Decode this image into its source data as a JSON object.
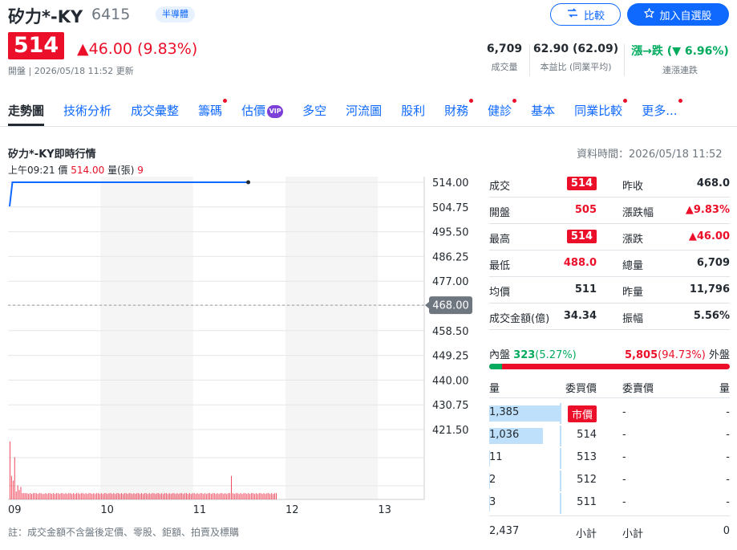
{
  "header": {
    "name": "矽力*-KY",
    "code": "6415",
    "badge": "半導體",
    "compare_label": "比較",
    "add_label": "加入自選股",
    "price": "514",
    "change": "▲46.00 (9.83%)",
    "update": "開盤 | 2026/05/18 11:52 更新"
  },
  "stats": [
    {
      "value": "6,709",
      "label": "成交量"
    },
    {
      "value": "62.90 (62.09)",
      "label": "本益比 (同業平均)"
    },
    {
      "value": "漲→跌 (▼ 6.96%)",
      "label": "連漲連跌"
    }
  ],
  "tabs": [
    {
      "label": "走勢圖",
      "active": true,
      "dot": false
    },
    {
      "label": "技術分析",
      "dot": false
    },
    {
      "label": "成交彙整",
      "dot": false
    },
    {
      "label": "籌碼",
      "dot": true
    },
    {
      "label": "估價",
      "dot": false,
      "vip": "VIP"
    },
    {
      "label": "多空",
      "dot": false
    },
    {
      "label": "河流圖",
      "dot": false
    },
    {
      "label": "股利",
      "dot": false
    },
    {
      "label": "財務",
      "dot": true
    },
    {
      "label": "健診",
      "dot": true
    },
    {
      "label": "基本",
      "dot": false
    },
    {
      "label": "同業比較",
      "dot": true
    },
    {
      "label": "更多...",
      "dot": true
    }
  ],
  "chart_section": {
    "title": "矽力*-KY即時行情",
    "data_time": "資料時間：2026/05/18 11:52",
    "tick_time": "上午09:21",
    "tick_price_label": "價",
    "tick_price": "514.00",
    "tick_vol_label": "量(張)",
    "tick_vol": "9",
    "note": "註：成交金額不含盤後定價、零股、鉅額、拍賣及標購"
  },
  "chart_data": {
    "type": "line",
    "x_ticks": [
      "09",
      "10",
      "11",
      "12",
      "13"
    ],
    "y_ticks": [
      "514.00",
      "504.75",
      "495.50",
      "486.25",
      "477.00",
      "468.00",
      "458.50",
      "449.25",
      "440.00",
      "430.75",
      "421.50"
    ],
    "ref_price": "468.00",
    "ylim": [
      421.5,
      514
    ],
    "price_series": [
      {
        "t": 0,
        "v": 505
      },
      {
        "t": 2,
        "v": 514
      },
      {
        "t": 172,
        "v": 514
      }
    ],
    "volume_bars": [
      74,
      30,
      24,
      54,
      10,
      18,
      12,
      16,
      8,
      8,
      8,
      8,
      7,
      8,
      7,
      8,
      8,
      8,
      7,
      8,
      8,
      7,
      7,
      8,
      7,
      8,
      8,
      7,
      8,
      7,
      8,
      8,
      7,
      8,
      8,
      7,
      8,
      7,
      8,
      8,
      7,
      8,
      7,
      8,
      8,
      7,
      8,
      8,
      7,
      8,
      7,
      8,
      8,
      7,
      8,
      7,
      8,
      8,
      7,
      8,
      7,
      8,
      8,
      7,
      8,
      8,
      7,
      8,
      7,
      8,
      8,
      7,
      8,
      7,
      8,
      8,
      7,
      8,
      8,
      7,
      8,
      7,
      8,
      8,
      7,
      8,
      7,
      8,
      8,
      7,
      8,
      7,
      8,
      8,
      7,
      8,
      8,
      7,
      8,
      7,
      8,
      8,
      7,
      8,
      7,
      8,
      8,
      7,
      8,
      7,
      8,
      8,
      7,
      8,
      8,
      7,
      8,
      7,
      8,
      8,
      7,
      8,
      7,
      8,
      8,
      7,
      8,
      7,
      8,
      8,
      7,
      8,
      8,
      7,
      8,
      7,
      8,
      8,
      7,
      8,
      7,
      8,
      8,
      30,
      8,
      7,
      8,
      8,
      7,
      8,
      7,
      8,
      8,
      7,
      8,
      7,
      8,
      8,
      7,
      8,
      7,
      8,
      8,
      7,
      8,
      7,
      8,
      8,
      7,
      8,
      7,
      8,
      8
    ],
    "colors": {
      "line": "#0f69ff",
      "volume": "#eb0f29"
    }
  },
  "quote": [
    {
      "l1": "成交",
      "v1": "514",
      "v1box": true,
      "l2": "昨收",
      "v2": "468.0",
      "v2class": ""
    },
    {
      "l1": "開盤",
      "v1": "505",
      "v1class": "red",
      "l2": "漲跌幅",
      "v2": "▲9.83%",
      "v2class": "red"
    },
    {
      "l1": "最高",
      "v1": "514",
      "v1box": true,
      "l2": "漲跌",
      "v2": "▲46.00",
      "v2class": "red"
    },
    {
      "l1": "最低",
      "v1": "488.0",
      "v1class": "red",
      "l2": "總量",
      "v2": "6,709",
      "v2class": ""
    },
    {
      "l1": "均價",
      "v1": "511",
      "v1class": "",
      "l2": "昨量",
      "v2": "11,796",
      "v2class": ""
    },
    {
      "l1": "成交金額(億)",
      "v1": "34.34",
      "v1class": "",
      "l2": "振幅",
      "v2": "5.56%",
      "v2class": ""
    }
  ],
  "inout": {
    "in_label": "內盤",
    "in_value": "323",
    "in_pct": "(5.27%)",
    "out_value": "5,805",
    "out_pct": "(94.73%)",
    "out_label": "外盤",
    "in_ratio": 0.0527
  },
  "orderbook": {
    "headers": {
      "vol": "量",
      "bid": "委買價",
      "ask": "委賣價",
      "askvol": "量"
    },
    "rows": [
      {
        "vol": "1,385",
        "bid": "市價",
        "ask": "-",
        "askvol": "-",
        "ratio": 1.0,
        "market": true
      },
      {
        "vol": "1,036",
        "bid": "514",
        "ask": "-",
        "askvol": "-",
        "ratio": 0.748
      },
      {
        "vol": "11",
        "bid": "513",
        "ask": "-",
        "askvol": "-",
        "ratio": 0.01
      },
      {
        "vol": "2",
        "bid": "512",
        "ask": "-",
        "askvol": "-",
        "ratio": 0.01
      },
      {
        "vol": "3",
        "bid": "511",
        "ask": "-",
        "askvol": "-",
        "ratio": 0.01
      }
    ],
    "sub_label": "小計",
    "bid_total": "2,437",
    "ask_total": "0"
  }
}
